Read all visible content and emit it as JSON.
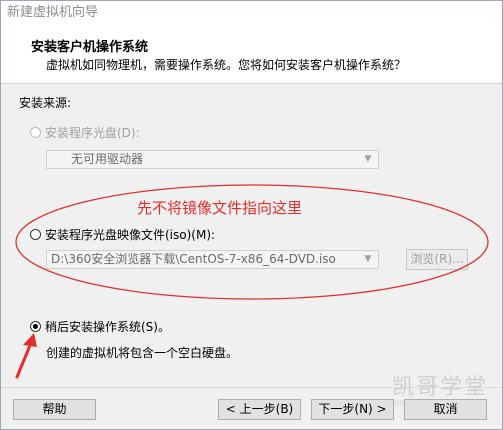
{
  "window": {
    "title": "新建虚拟机向导"
  },
  "header": {
    "title": "安装客户机操作系统",
    "description": "虚拟机如同物理机，需要操作系统。您将如何安装客户机操作系统？"
  },
  "install_source": {
    "label": "安装来源:",
    "options": [
      {
        "label": "安装程序光盘(D):",
        "selected": false,
        "enabled": false
      },
      {
        "label": "安装程序光盘映像文件(iso)(M):",
        "selected": false,
        "enabled": true
      },
      {
        "label": "稍后安装操作系统(S)。",
        "selected": true,
        "enabled": true
      }
    ],
    "disc_drive": {
      "value": "无可用驱动器"
    },
    "iso_path": {
      "value": "D:\\360安全浏览器下载\\CentOS-7-x86_64-DVD.iso"
    },
    "browse_label": "浏览(R)...",
    "later_hint": "创建的虚拟机将包含一个空白硬盘。"
  },
  "annotation": {
    "text": "先不将镜像文件指向这里",
    "color": "#e0302a"
  },
  "footer": {
    "help_label": "帮助",
    "back_label": "< 上一步(B)",
    "next_label": "下一步(N) >",
    "cancel_label": "取消"
  },
  "watermark": {
    "text": "凯哥学堂",
    "url": "http://kaige.ke"
  },
  "colors": {
    "annotation_red": "#e0302a",
    "window_bg": "#f0f0f0"
  }
}
